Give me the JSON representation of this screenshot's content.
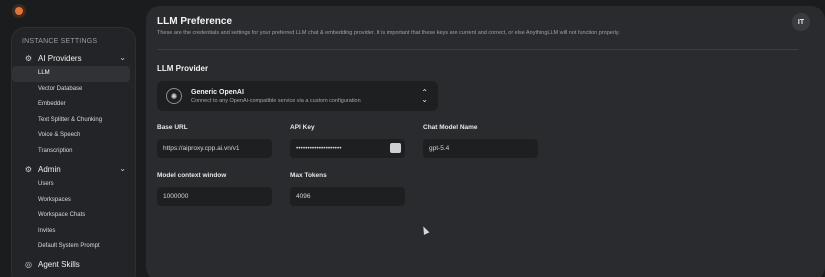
{
  "sidebar": {
    "heading": "INSTANCE SETTINGS",
    "groups": [
      {
        "label": "AI Providers",
        "icon": "cpu-icon",
        "items": [
          "LLM",
          "Vector Database",
          "Embedder",
          "Text Splitter & Chunking",
          "Voice & Speech",
          "Transcription"
        ]
      },
      {
        "label": "Admin",
        "icon": "user-gear-icon",
        "items": [
          "Users",
          "Workspaces",
          "Workspace Chats",
          "Invites",
          "Default System Prompt"
        ]
      },
      {
        "label": "Agent Skills",
        "icon": "robot-icon",
        "items": []
      }
    ],
    "active_item": "LLM"
  },
  "header": {
    "title": "LLM Preference",
    "description": "These are the credentials and settings for your preferred LLM chat & embedding provider. It is important that these keys are current and correct, or else AnythingLLM will not function properly.",
    "avatar_initials": "IT"
  },
  "provider": {
    "section_title": "LLM Provider",
    "name": "Generic OpenAI",
    "description": "Connect to any OpenAi-compatible service via a custom configuration"
  },
  "fields": {
    "base_url": {
      "label": "Base URL",
      "value": "https://aiproxy.cpp.ai.vn/v1"
    },
    "api_key": {
      "label": "API Key",
      "value": "••••••••••••••••••••"
    },
    "chat_model": {
      "label": "Chat Model Name",
      "value": "gpt-5.4"
    },
    "context_window": {
      "label": "Model context window",
      "value": "1000000"
    },
    "max_tokens": {
      "label": "Max Tokens",
      "value": "4096"
    }
  },
  "colors": {
    "background": "#1b1c1e",
    "panel": "#2a2b2e",
    "input": "#1e1f21",
    "brand": "#e2743a"
  }
}
